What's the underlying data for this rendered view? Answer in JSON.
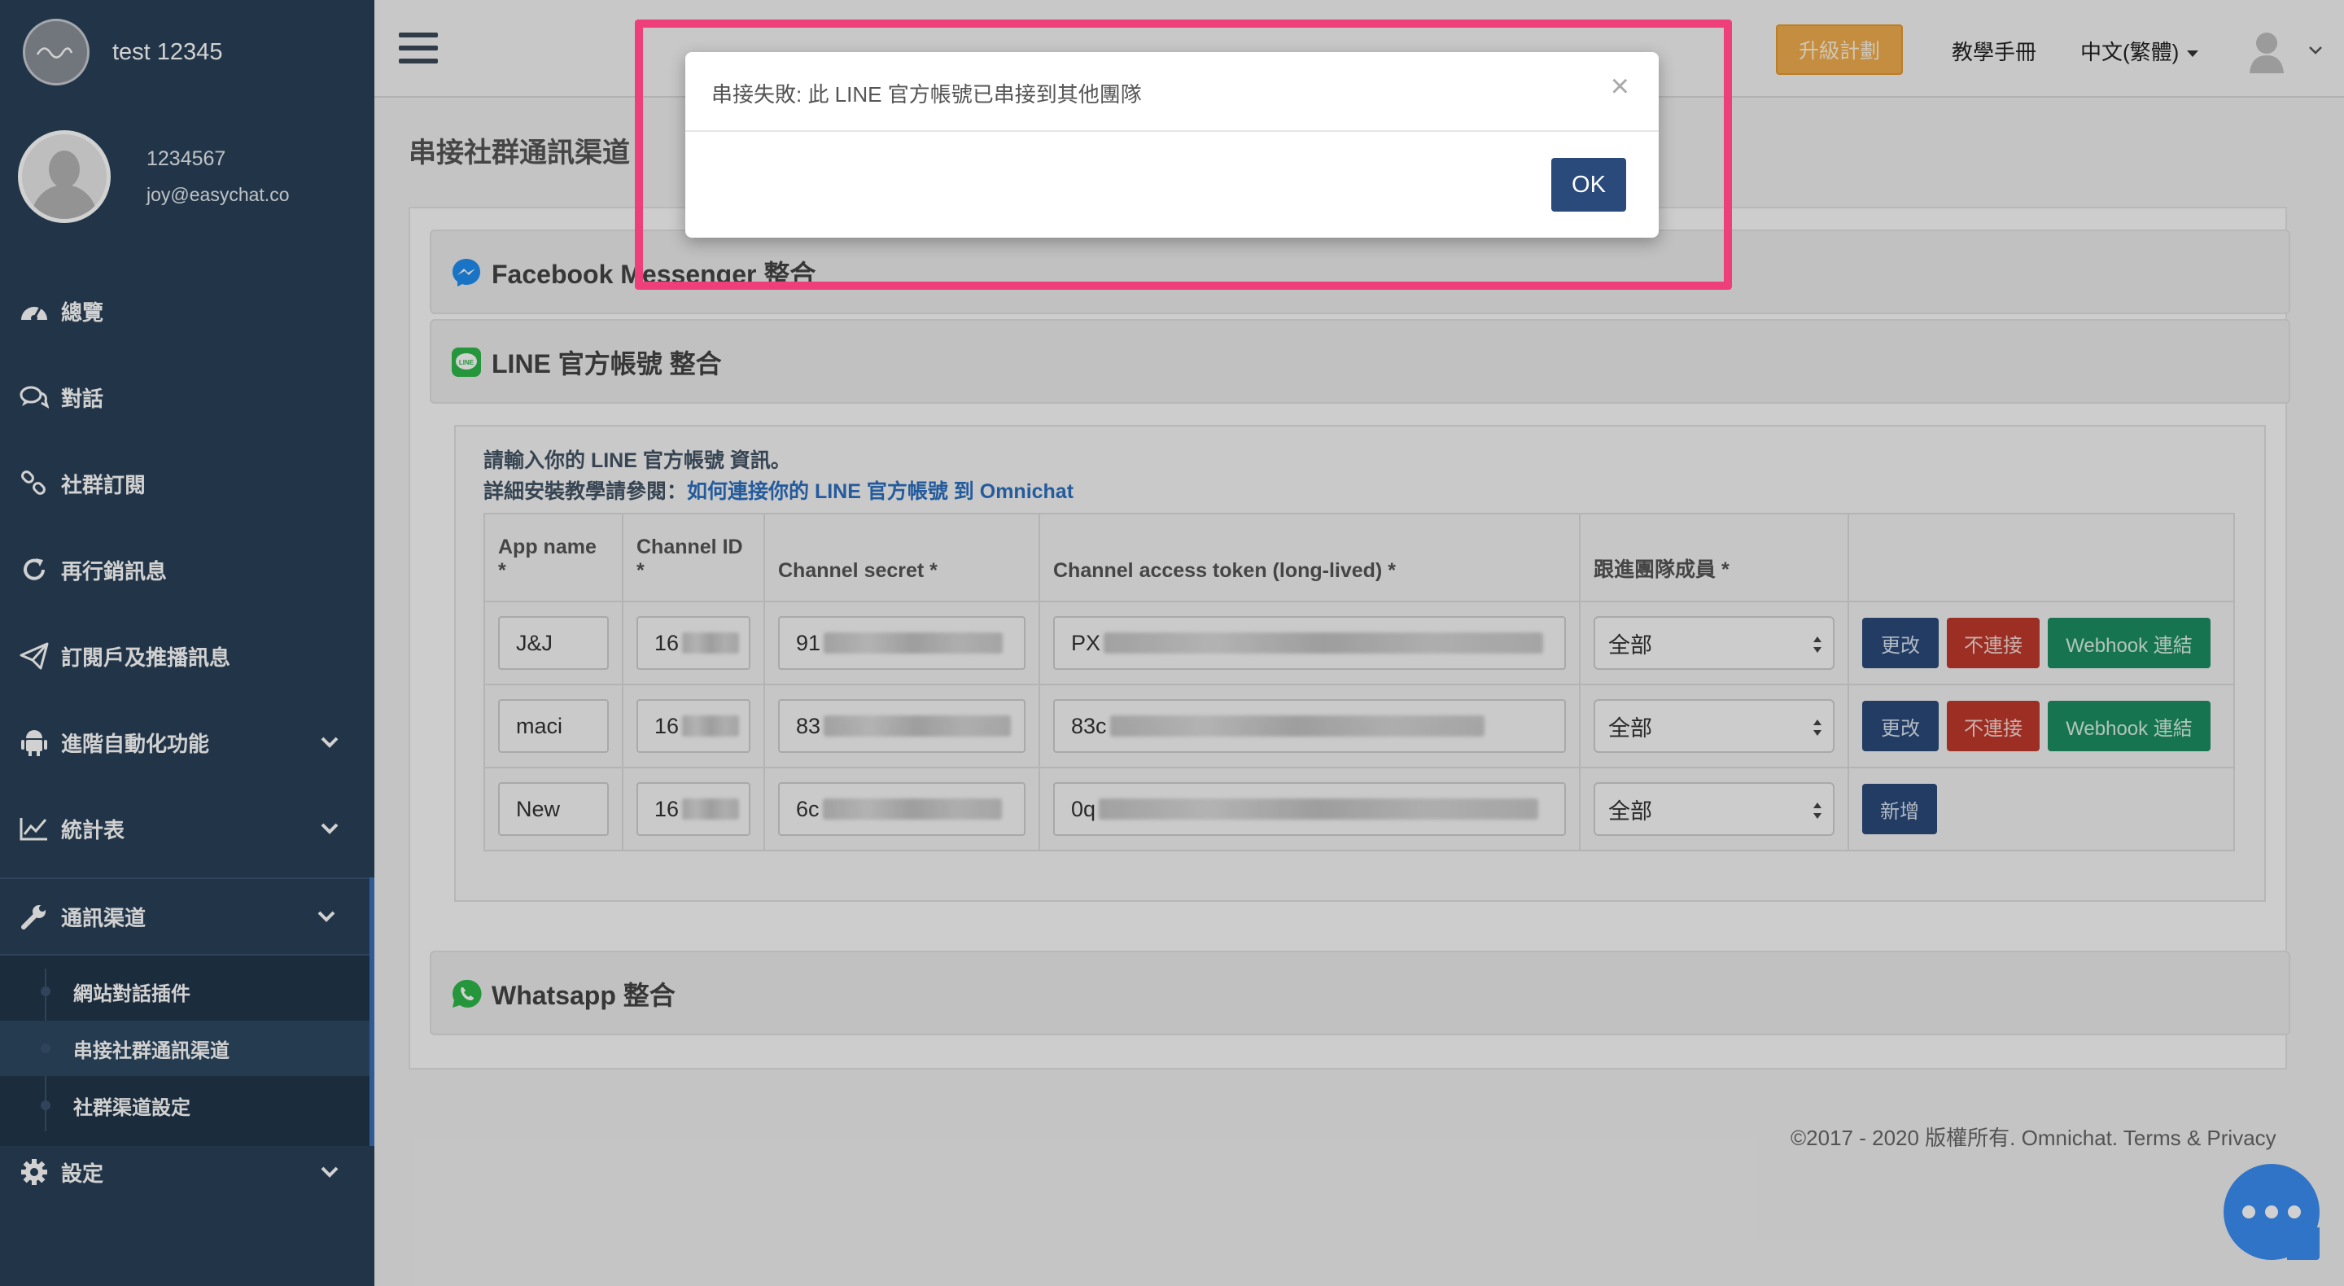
{
  "brand": {
    "name": "test 12345"
  },
  "profile": {
    "id": "1234567",
    "email": "joy@easychat.co"
  },
  "sidebar": {
    "items": [
      {
        "label": "總覽",
        "icon": "dashboard-icon"
      },
      {
        "label": "對話",
        "icon": "chat-icon"
      },
      {
        "label": "社群訂閱",
        "icon": "link-icon"
      },
      {
        "label": "再行銷訊息",
        "icon": "refresh-icon"
      },
      {
        "label": "訂閱戶及推播訊息",
        "icon": "paper-plane-icon"
      },
      {
        "label": "進階自動化功能",
        "icon": "android-icon"
      },
      {
        "label": "統計表",
        "icon": "line-chart-icon"
      },
      {
        "label": "通訊渠道",
        "icon": "wrench-icon"
      },
      {
        "label": "設定",
        "icon": "gear-icon"
      }
    ],
    "subitems": [
      {
        "label": "網站對話插件"
      },
      {
        "label": "串接社群通訊渠道"
      },
      {
        "label": "社群渠道設定"
      }
    ]
  },
  "topbar": {
    "upgrade": "升級計劃",
    "manual": "教學手冊",
    "language": "中文(繁體)"
  },
  "page": {
    "title": "串接社群通訊渠道",
    "sections": {
      "facebook": "Facebook Messenger 整合",
      "line": "LINE 官方帳號 整合",
      "whatsapp": "Whatsapp 整合"
    },
    "hint1": "請輸入你的 LINE 官方帳號 資訊。",
    "hint2_prefix": "詳細安裝教學請參閱：",
    "hint2_link": "如何連接你的 LINE 官方帳號 到 Omnichat"
  },
  "table": {
    "headers": [
      "App name *",
      "Channel ID *",
      "Channel secret *",
      "Channel access token (long-lived) *",
      "跟進團隊成員 *"
    ],
    "rows": [
      {
        "app": "J&J",
        "channel_id": "16",
        "secret": "91",
        "token": "PX",
        "team": "全部",
        "actions": [
          "更改",
          "不連接",
          "Webhook 連結"
        ]
      },
      {
        "app": "maci",
        "channel_id": "16",
        "secret": "83",
        "token": "83c",
        "team": "全部",
        "actions": [
          "更改",
          "不連接",
          "Webhook 連結"
        ]
      },
      {
        "app": "New",
        "channel_id": "16",
        "secret": "6c",
        "token": "0q",
        "team": "全部",
        "actions": [
          "新增"
        ]
      }
    ]
  },
  "footer": {
    "text": "©2017 - 2020 版權所有. Omnichat. Terms & Privacy"
  },
  "modal": {
    "message": "串接失敗: 此 LINE 官方帳號已串接到其他團隊",
    "close": "×",
    "ok": "OK"
  },
  "colors": {
    "sidebar": "#2a4158",
    "primary": "#2a4a7b",
    "danger": "#c0392b",
    "success": "#1b8f62",
    "warning": "#f0ad4e",
    "highlight": "#ee3f7a",
    "chat": "#3b8ef5"
  }
}
